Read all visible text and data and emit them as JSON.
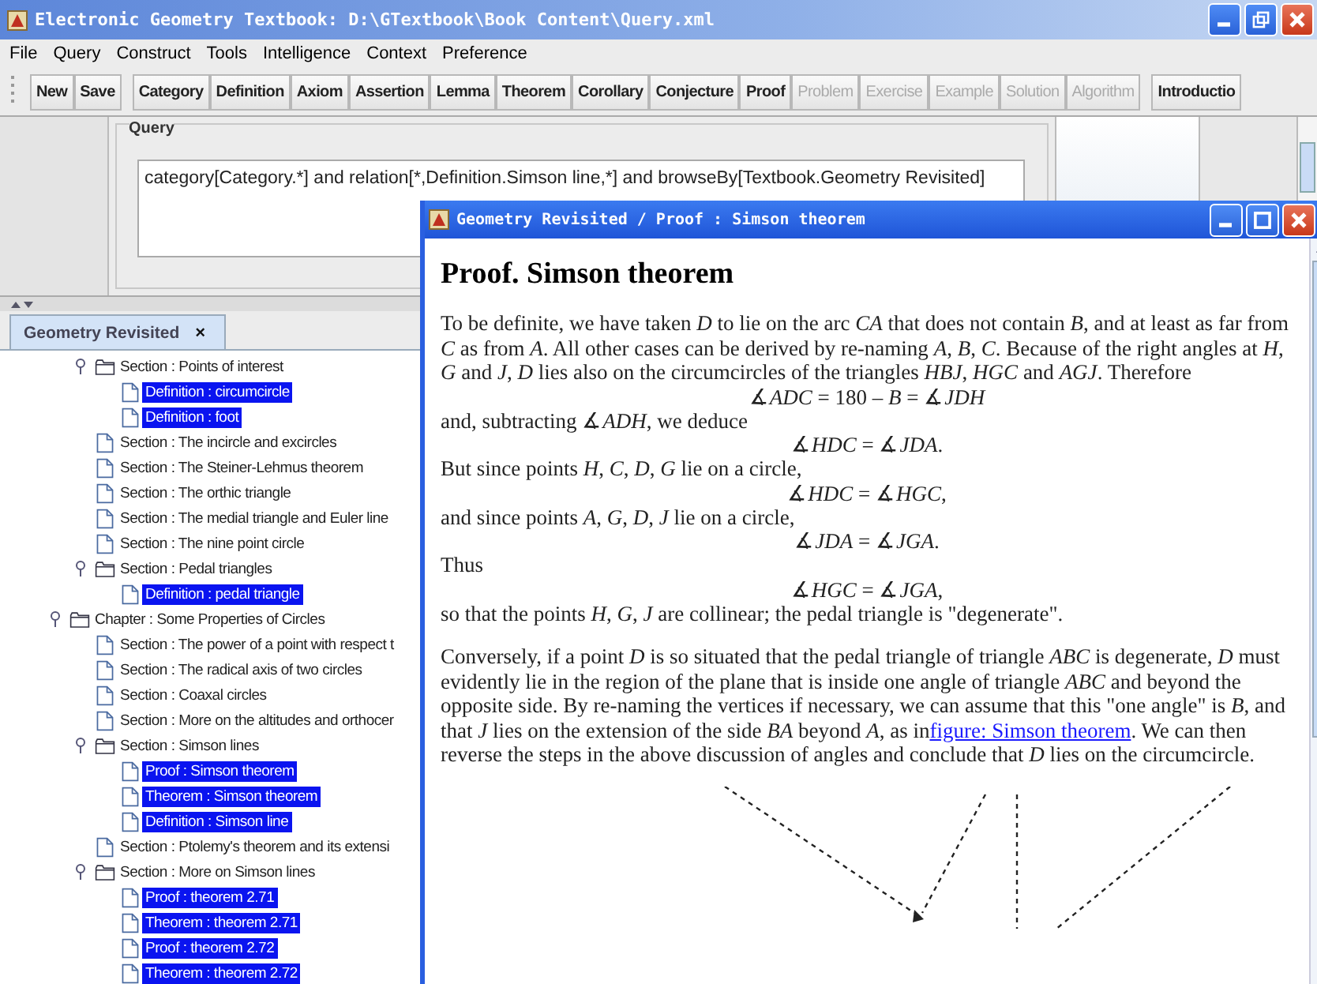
{
  "window": {
    "title": "Electronic Geometry Textbook: D:\\GTextbook\\Book Content\\Query.xml"
  },
  "menu": [
    "File",
    "Query",
    "Construct",
    "Tools",
    "Intelligence",
    "Context",
    "Preference"
  ],
  "toolbar": {
    "groups": [
      [
        {
          "label": "New",
          "disabled": false
        },
        {
          "label": "Save",
          "disabled": false
        }
      ],
      [
        {
          "label": "Category",
          "disabled": false
        },
        {
          "label": "Definition",
          "disabled": false
        },
        {
          "label": "Axiom",
          "disabled": false
        },
        {
          "label": "Assertion",
          "disabled": false
        },
        {
          "label": "Lemma",
          "disabled": false
        },
        {
          "label": "Theorem",
          "disabled": false
        },
        {
          "label": "Corollary",
          "disabled": false
        },
        {
          "label": "Conjecture",
          "disabled": false
        },
        {
          "label": "Proof",
          "disabled": false
        },
        {
          "label": "Problem",
          "disabled": true
        },
        {
          "label": "Exercise",
          "disabled": true
        },
        {
          "label": "Example",
          "disabled": true
        },
        {
          "label": "Solution",
          "disabled": true
        },
        {
          "label": "Algorithm",
          "disabled": true
        }
      ],
      [
        {
          "label": "Introductio",
          "disabled": false
        }
      ]
    ]
  },
  "query": {
    "title": "Query",
    "value": "category[Category.*] and relation[*,Definition.Simson line,*] and browseBy[Textbook.Geometry Revisited]"
  },
  "tabs": [
    {
      "label": "Geometry Revisited",
      "selected": true,
      "close": "×"
    }
  ],
  "tree": {
    "items": [
      {
        "children": [
          {
            "label": "Section : Points of interest",
            "kind": "folder",
            "expanded": true,
            "selected": false,
            "children": [
              {
                "label": "Definition : circumcircle",
                "kind": "doc",
                "selected": true
              },
              {
                "label": "Definition : foot",
                "kind": "doc",
                "selected": true
              }
            ]
          },
          {
            "label": "Section : The incircle and excircles",
            "kind": "doc",
            "selected": false
          },
          {
            "label": "Section : The Steiner-Lehmus theorem",
            "kind": "doc",
            "selected": false
          },
          {
            "label": "Section : The orthic triangle",
            "kind": "doc",
            "selected": false
          },
          {
            "label": "Section : The medial triangle and Euler line",
            "kind": "doc",
            "selected": false
          },
          {
            "label": "Section : The nine point circle",
            "kind": "doc",
            "selected": false
          },
          {
            "label": "Section : Pedal triangles",
            "kind": "folder",
            "expanded": true,
            "selected": false,
            "children": [
              {
                "label": "Definition : pedal triangle",
                "kind": "doc",
                "selected": true
              }
            ]
          }
        ]
      },
      {
        "label": "Chapter : Some Properties of Circles",
        "kind": "folder",
        "expanded": true,
        "selected": false,
        "children": [
          {
            "label": "Section : The power of a point with respect t",
            "kind": "doc",
            "selected": false
          },
          {
            "label": "Section : The radical axis of two circles",
            "kind": "doc",
            "selected": false
          },
          {
            "label": "Section : Coaxal circles",
            "kind": "doc",
            "selected": false
          },
          {
            "label": "Section : More on the altitudes and orthocer",
            "kind": "doc",
            "selected": false
          },
          {
            "label": "Section : Simson lines",
            "kind": "folder",
            "expanded": true,
            "selected": false,
            "children": [
              {
                "label": "Proof : Simson theorem",
                "kind": "doc",
                "selected": true
              },
              {
                "label": "Theorem : Simson theorem",
                "kind": "doc",
                "selected": true
              },
              {
                "label": "Definition : Simson line",
                "kind": "doc",
                "selected": true
              }
            ]
          },
          {
            "label": "Section : Ptolemy's theorem and its extensi",
            "kind": "doc",
            "selected": false
          },
          {
            "label": "Section : More on Simson lines",
            "kind": "folder",
            "expanded": true,
            "selected": false,
            "children": [
              {
                "label": "Proof : theorem 2.71",
                "kind": "doc",
                "selected": true
              },
              {
                "label": "Theorem : theorem 2.71",
                "kind": "doc",
                "selected": true
              },
              {
                "label": "Proof : theorem 2.72",
                "kind": "doc",
                "selected": true
              },
              {
                "label": "Theorem : theorem 2.72",
                "kind": "doc",
                "selected": true
              }
            ]
          }
        ]
      }
    ]
  },
  "proof_window": {
    "title": "Geometry Revisited / Proof : Simson theorem",
    "heading": "Proof. Simson theorem",
    "paragraphs": [
      [
        {
          "kind": "text",
          "text": "To be definite, we have taken *D* to lie on the arc *CA* that does not contain *B*, and at least as far from *C* as from *A*. All other cases can be derived by re-naming *A*, *B*, *C*. Because of the right angles at *H*, *G* and *J*, *D* lies also on the circumcircles of the triangles *HBJ*, *HGC* and *AGJ*. Therefore"
        },
        {
          "kind": "formula",
          "text": "∡*ADC* = 180 – *B* = ∡*JDH*"
        },
        {
          "kind": "text",
          "text": "and, subtracting ∡*ADH*, we deduce"
        },
        {
          "kind": "formula",
          "text": "∡*HDC* = ∡*JDA*."
        },
        {
          "kind": "text",
          "text": "But since points *H*, *C*, *D*, *G* lie on a circle,"
        },
        {
          "kind": "formula",
          "text": "∡*HDC* = ∡*HGC*,"
        },
        {
          "kind": "text",
          "text": "and since points *A*, *G*, *D*, *J* lie on a circle,"
        },
        {
          "kind": "formula",
          "text": "∡*JDA* = ∡*JGA*."
        },
        {
          "kind": "text",
          "text": "Thus"
        },
        {
          "kind": "formula",
          "text": "∡*HGC* = ∡*JGA*,"
        },
        {
          "kind": "text",
          "text": "so that the points *H*, *G*, *J* are collinear; the pedal triangle is \"degenerate\"."
        }
      ],
      [
        {
          "kind": "text",
          "text": "Conversely, if a point *D* is so situated that the pedal triangle of triangle *ABC* is degenerate, *D* must evidently lie in the region of the plane that is inside one angle of triangle *ABC* and beyond the opposite side. By re-naming the vertices if necessary, we can assume that this \"one angle\" is *B*, and that *J* lies on the extension of the side *BA* beyond *A*, as in",
          "link": "figure: Simson theorem",
          "after": ". We can then reverse the steps in the above discussion of angles and conclude that *D* lies on the circumcircle."
        }
      ]
    ]
  }
}
